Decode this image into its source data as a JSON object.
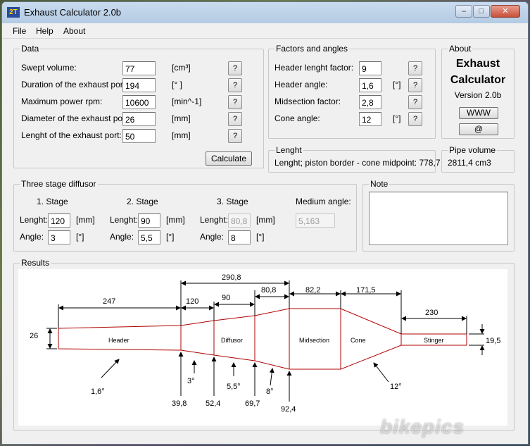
{
  "window": {
    "title": "Exhaust Calculator 2.0b",
    "icon_text": "2T",
    "controls": [
      "minimize-icon",
      "maximize-icon",
      "close-icon"
    ]
  },
  "menu": [
    "File",
    "Help",
    "About"
  ],
  "data_group": {
    "legend": "Data",
    "rows": [
      {
        "label": "Swept volume:",
        "value": "77",
        "unit": "[cm³]",
        "help": "?"
      },
      {
        "label": "Duration of the exhaust port:",
        "value": "194",
        "unit": "[° ]",
        "help": "?"
      },
      {
        "label": "Maximum power rpm:",
        "value": "10600",
        "unit": "[min^-1]",
        "help": "?"
      },
      {
        "label": "Diameter of the exhaust port:",
        "value": "26",
        "unit": "[mm]",
        "help": "?"
      },
      {
        "label": "Lenght of the exhaust port:",
        "value": "50",
        "unit": "[mm]",
        "help": "?"
      }
    ],
    "calculate_label": "Calculate"
  },
  "factors_group": {
    "legend": "Factors and angles",
    "rows": [
      {
        "label": "Header lenght factor:",
        "value": "9",
        "unit": "",
        "help": "?"
      },
      {
        "label": "Header angle:",
        "value": "1,6",
        "unit": "[°]",
        "help": "?"
      },
      {
        "label": "Midsection factor:",
        "value": "2,8",
        "unit": "",
        "help": "?"
      },
      {
        "label": "Cone angle:",
        "value": "12",
        "unit": "[°]",
        "help": "?"
      }
    ]
  },
  "about_group": {
    "legend": "About",
    "title_line1": "Exhaust",
    "title_line2": "Calculator",
    "version": "Version 2.0b",
    "www_label": "WWW",
    "email_label": "@"
  },
  "lenght_group": {
    "legend": "Lenght",
    "text": "Lenght; piston border - cone midpoint:  778,7"
  },
  "pipe_volume_group": {
    "legend": "Pipe volume",
    "text": "2811,4 cm3"
  },
  "diffusor_group": {
    "legend": "Three stage diffusor",
    "stages": [
      {
        "title": "1. Stage",
        "lenght_label": "Lenght:",
        "lenght": "120",
        "lenght_unit": "[mm]",
        "angle_label": "Angle:",
        "angle": "3",
        "angle_unit": "[°]"
      },
      {
        "title": "2. Stage",
        "lenght_label": "Lenght:",
        "lenght": "90",
        "lenght_unit": "[mm]",
        "angle_label": "Angle:",
        "angle": "5,5",
        "angle_unit": "[°]"
      },
      {
        "title": "3. Stage",
        "lenght_label": "Lenght:",
        "lenght": "80,8",
        "lenght_unit": "[mm]",
        "angle_label": "Angle:",
        "angle": "8",
        "angle_unit": "[°]"
      }
    ],
    "medium_angle_label": "Medium angle:",
    "medium_angle": "5,163"
  },
  "note_group": {
    "legend": "Note",
    "text": ""
  },
  "results_group": {
    "legend": "Results",
    "drawing": {
      "section_labels": [
        "Header",
        "Diffusor",
        "Midsection",
        "Cone",
        "Stinger"
      ],
      "top_dims": [
        "247",
        "120",
        "290,8",
        "90",
        "80,8",
        "82,2",
        "171,5",
        "230"
      ],
      "port_diameter": "26",
      "stinger_diameter": "19,5",
      "bottom_dims": [
        "39,8",
        "52,4",
        "69,7",
        "92,4"
      ],
      "angles": [
        "1,6°",
        "3°",
        "5,5°",
        "8°",
        "12°"
      ]
    }
  },
  "watermark": "bikepics"
}
